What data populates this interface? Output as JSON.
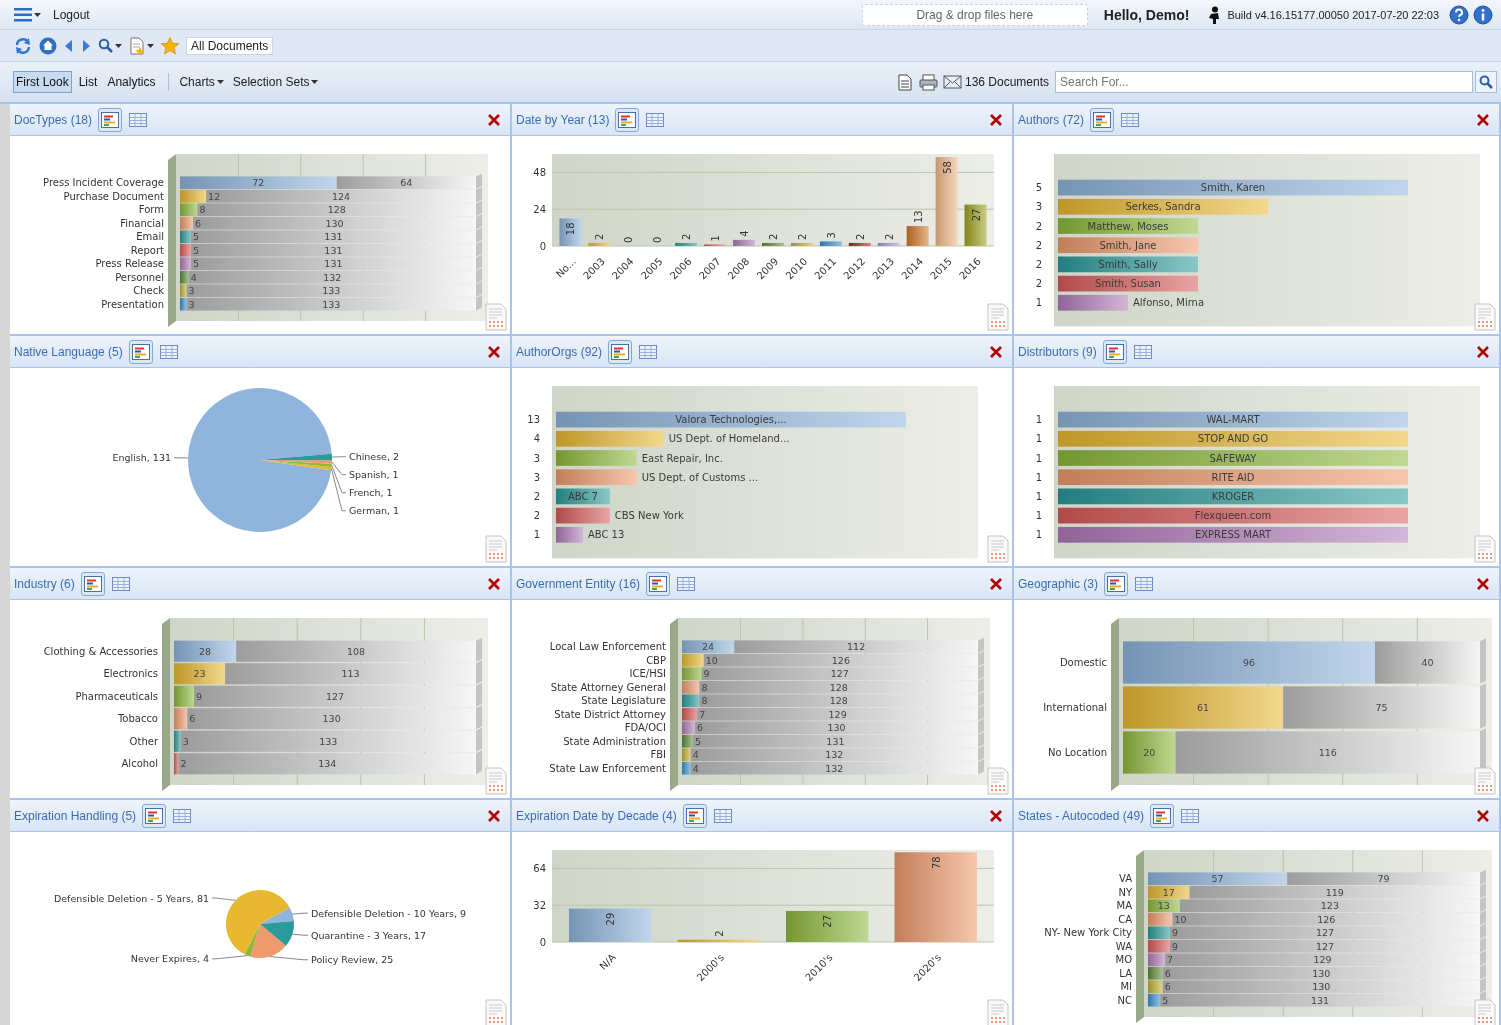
{
  "top_bar": {
    "logout": "Logout",
    "drop_zone": "Drag & drop files here",
    "greeting": "Hello, Demo!",
    "build": "Build v4.16.15177.00050 2017-07-20 22:03"
  },
  "nav_bar": {
    "location": "All Documents"
  },
  "view_bar": {
    "tabs": [
      {
        "label": "First Look",
        "selected": true
      },
      {
        "label": "List",
        "selected": false
      },
      {
        "label": "Analytics",
        "selected": false
      }
    ],
    "menus": [
      "Charts",
      "Selection Sets"
    ],
    "document_count": "136 Documents",
    "search": {
      "placeholder": "Search For..."
    }
  },
  "panels": [
    {
      "title": "DocTypes (18)",
      "chart_view": true,
      "chart_data": {
        "type": "bar",
        "orientation": "horizontal",
        "stacked": true,
        "data_labels": true,
        "categories": [
          "Press Incident Coverage",
          "Purchase Document",
          "Form",
          "Financial",
          "Email",
          "Report",
          "Press Release",
          "Personnel",
          "Check",
          "Presentation"
        ],
        "series": [
          {
            "values": [
              72,
              12,
              8,
              6,
              5,
              5,
              5,
              4,
              3,
              3
            ]
          },
          {
            "values": [
              64,
              124,
              128,
              130,
              131,
              131,
              131,
              132,
              133,
              133
            ]
          }
        ]
      }
    },
    {
      "title": "Date by Year (13)",
      "chart_view": true,
      "chart_data": {
        "type": "bar",
        "orientation": "vertical",
        "data_labels": true,
        "categories": [
          "No...",
          "2003",
          "2004",
          "2005",
          "2006",
          "2007",
          "2008",
          "2009",
          "2010",
          "2011",
          "2012",
          "2013",
          "2014",
          "2015",
          "2016"
        ],
        "values": [
          18,
          2,
          0,
          0,
          2,
          1,
          4,
          2,
          2,
          3,
          2,
          2,
          13,
          58,
          27
        ],
        "yticks": [
          0,
          24,
          48
        ],
        "ylim": [
          0,
          60
        ]
      }
    },
    {
      "title": "Authors (72)",
      "chart_view": true,
      "chart_data": {
        "type": "bar",
        "orientation": "horizontal",
        "stacked": false,
        "data_labels": true,
        "categories": [
          "Smith, Karen",
          "Serkes, Sandra",
          "Matthew, Moses",
          "Smith, Jane",
          "Smith, Sally",
          "Smith, Susan",
          "Alfonso, Mirna"
        ],
        "values": [
          5,
          3,
          2,
          2,
          2,
          2,
          1
        ]
      }
    },
    {
      "title": "Native Language (5)",
      "chart_view": true,
      "chart_data": {
        "type": "pie",
        "values": [
          131,
          1,
          1,
          1,
          2
        ],
        "value_labels": [
          "English, 131",
          "German, 1",
          "French, 1",
          "Spanish, 1",
          "Chinese, 2"
        ]
      }
    },
    {
      "title": "AuthorOrgs (92)",
      "chart_view": true,
      "chart_data": {
        "type": "bar",
        "orientation": "horizontal",
        "stacked": false,
        "data_labels": true,
        "categories": [
          "Valora Technologies,...",
          "US Dept. of Homeland...",
          "East Repair, Inc.",
          "US Dept. of Customs ...",
          "ABC 7",
          "CBS New York",
          "ABC 13"
        ],
        "values": [
          13,
          4,
          3,
          3,
          2,
          2,
          1
        ]
      }
    },
    {
      "title": "Distributors (9)",
      "chart_view": true,
      "chart_data": {
        "type": "bar",
        "orientation": "horizontal",
        "stacked": false,
        "data_labels": true,
        "categories": [
          "WAL-MART",
          "STOP AND GO",
          "SAFEWAY",
          "RITE AID",
          "KROGER",
          "Flexqueen.com",
          "EXPRESS MART"
        ],
        "values": [
          1,
          1,
          1,
          1,
          1,
          1,
          1
        ]
      }
    },
    {
      "title": "Industry (6)",
      "chart_view": true,
      "chart_data": {
        "type": "bar",
        "orientation": "horizontal",
        "stacked": true,
        "data_labels": true,
        "categories": [
          "Clothing & Accessories",
          "Electronics",
          "Pharmaceuticals",
          "Tobacco",
          "Other",
          "Alcohol"
        ],
        "series": [
          {
            "values": [
              28,
              23,
              9,
              6,
              3,
              2
            ]
          },
          {
            "values": [
              108,
              113,
              127,
              130,
              133,
              134
            ]
          }
        ]
      }
    },
    {
      "title": "Government Entity (16)",
      "chart_view": true,
      "chart_data": {
        "type": "bar",
        "orientation": "horizontal",
        "stacked": true,
        "data_labels": true,
        "categories": [
          "Local Law Enforcement",
          "CBP",
          "ICE/HSI",
          "State Attorney General",
          "State Legislature",
          "State District Attorney",
          "FDA/OCI",
          "State Administration",
          "FBI",
          "State Law Enforcement"
        ],
        "series": [
          {
            "values": [
              24,
              10,
              9,
              8,
              8,
              7,
              6,
              5,
              4,
              4
            ]
          },
          {
            "values": [
              112,
              126,
              127,
              128,
              128,
              129,
              130,
              131,
              132,
              132
            ]
          }
        ]
      }
    },
    {
      "title": "Geographic (3)",
      "chart_view": true,
      "chart_data": {
        "type": "bar",
        "orientation": "horizontal",
        "stacked": true,
        "data_labels": true,
        "categories": [
          "Domestic",
          "International",
          "No Location"
        ],
        "series": [
          {
            "values": [
              96,
              61,
              20
            ]
          },
          {
            "values": [
              40,
              75,
              116
            ]
          }
        ]
      }
    },
    {
      "title": "Expiration Handling (5)",
      "chart_view": true,
      "chart_data": {
        "type": "pie",
        "values": [
          9,
          81,
          4,
          25,
          17
        ],
        "value_labels": [
          "Defensible Deletion - 10 Years, 9",
          "Defensible Deletion - 5 Years, 81",
          "Never Expires, 4",
          "Policy Review, 25",
          "Quarantine - 3 Years, 17"
        ]
      }
    },
    {
      "title": "Expiration Date by Decade (4)",
      "chart_view": true,
      "chart_data": {
        "type": "bar",
        "orientation": "vertical",
        "data_labels": true,
        "categories": [
          "N/A",
          "2000's",
          "2010's",
          "2020's"
        ],
        "values": [
          29,
          2,
          27,
          78
        ],
        "yticks": [
          0,
          32,
          64
        ],
        "ylim": [
          0,
          80
        ]
      }
    },
    {
      "title": "States - Autocoded (49)",
      "chart_view": true,
      "chart_data": {
        "type": "bar",
        "orientation": "horizontal",
        "stacked": true,
        "data_labels": true,
        "categories": [
          "VA",
          "NY",
          "MA",
          "CA",
          "NY- New York City",
          "WA",
          "MO",
          "LA",
          "MI",
          "NC"
        ],
        "series": [
          {
            "values": [
              57,
              17,
              13,
              10,
              9,
              9,
              7,
              6,
              6,
              5
            ]
          },
          {
            "values": [
              79,
              119,
              123,
              126,
              127,
              127,
              129,
              130,
              130,
              131
            ]
          }
        ]
      }
    }
  ]
}
